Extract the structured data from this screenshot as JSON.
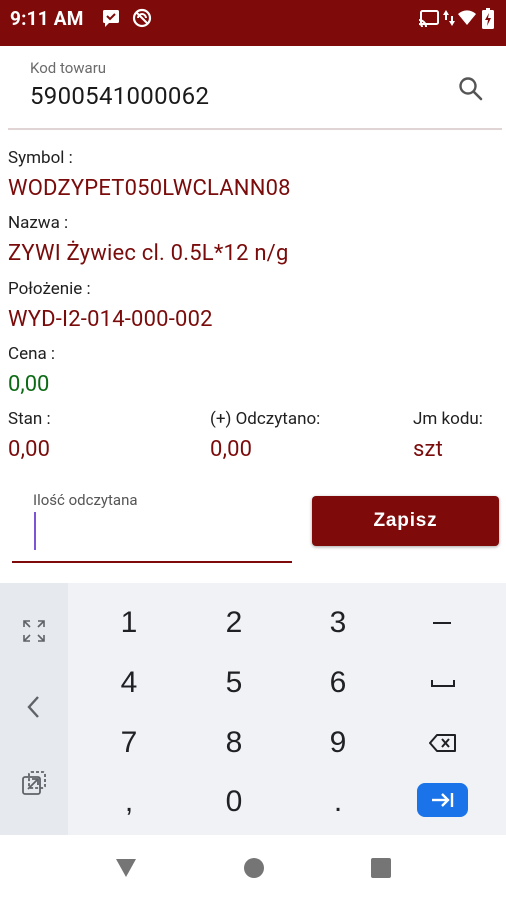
{
  "status_bar": {
    "time": "9:11 AM",
    "icons": [
      "message-icon",
      "dnd-icon",
      "cast-icon",
      "data-arrows-icon",
      "wifi-icon",
      "battery-icon"
    ]
  },
  "search": {
    "hint": "Kod towaru",
    "value": "5900541000062",
    "icon": "search-icon"
  },
  "product": {
    "symbol_label": "Symbol :",
    "symbol_value": "WODZYPET050LWCLANN08",
    "name_label": "Nazwa :",
    "name_value": "ZYWI Żywiec cl. 0.5L*12 n/g",
    "location_label": "Położenie :",
    "location_value": "WYD-I2-014-000-002",
    "price_label": "Cena :",
    "price_value": "0,00",
    "stock_label": "Stan :",
    "stock_value": "0,00",
    "read_label": "(+) Odczytano:",
    "read_value": "0,00",
    "unit_label": "Jm kodu:",
    "unit_value": "szt"
  },
  "quantity": {
    "hint": "Ilość odczytana",
    "value": ""
  },
  "save_button": "Zapisz",
  "keyboard": {
    "side_icons": [
      "expand-icon",
      "back-arrow-icon",
      "popout-icon"
    ],
    "rows": [
      [
        "1",
        "2",
        "3",
        "−"
      ],
      [
        "4",
        "5",
        "6",
        "␣"
      ],
      [
        "7",
        "8",
        "9",
        "⌫"
      ],
      [
        ",",
        "0",
        ".",
        "⇥"
      ]
    ]
  },
  "navigation": {
    "icons": [
      "back-triangle-icon",
      "home-circle-icon",
      "recents-square-icon"
    ]
  },
  "colors": {
    "brand": "#7f0a0a",
    "value_red": "#7a0b0b",
    "value_green": "#0c6b14",
    "enter_key": "#1a73e8",
    "cursor": "#7b55d6"
  }
}
